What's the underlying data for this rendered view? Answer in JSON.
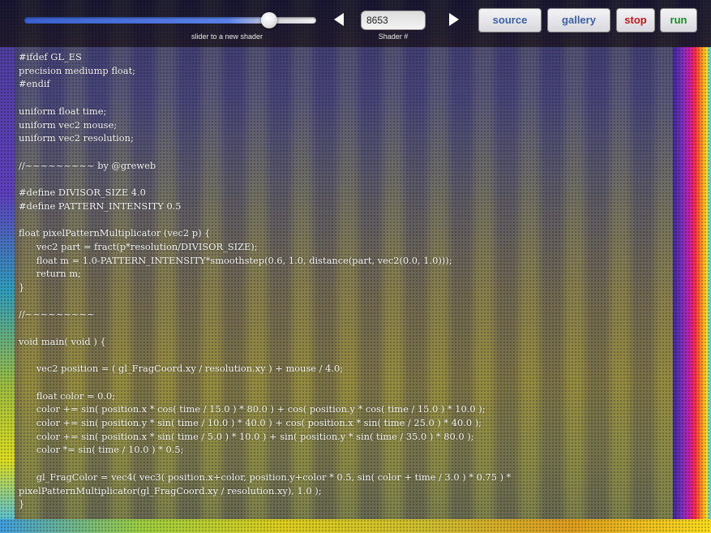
{
  "toolbar": {
    "slider_caption": "slider to a new shader",
    "slider_value": 0.84,
    "shader_number": "8653",
    "shader_caption": "Shader #",
    "source_label": "source",
    "gallery_label": "gallery",
    "stop_label": "stop",
    "run_label": "run",
    "prev_icon": "triangle-left",
    "next_icon": "triangle-right"
  },
  "colors": {
    "source_text": "#3a5fa8",
    "gallery_text": "#3a5fa8",
    "stop_text": "#c01818",
    "run_text": "#1a8a2a",
    "code_text": "#f2f2f2"
  },
  "code": "#ifdef GL_ES\nprecision mediump float;\n#endif\n\nuniform float time;\nuniform vec2 mouse;\nuniform vec2 resolution;\n\n//~~~~~~~~~ by @greweb\n\n#define DIVISOR_SIZE 4.0\n#define PATTERN_INTENSITY 0.5\n\nfloat pixelPatternMultiplicator (vec2 p) {\n      vec2 part = fract(p*resolution/DIVISOR_SIZE);\n      float m = 1.0-PATTERN_INTENSITY*smoothstep(0.6, 1.0, distance(part, vec2(0.0, 1.0)));\n      return m;\n}\n\n//~~~~~~~~~\n\nvoid main( void ) {\n\n      vec2 position = ( gl_FragCoord.xy / resolution.xy ) + mouse / 4.0;\n\n      float color = 0.0;\n      color += sin( position.x * cos( time / 15.0 ) * 80.0 ) + cos( position.y * cos( time / 15.0 ) * 10.0 );\n      color += sin( position.y * sin( time / 10.0 ) * 40.0 ) + cos( position.x * sin( time / 25.0 ) * 40.0 );\n      color += sin( position.x * sin( time / 5.0 ) * 10.0 ) + sin( position.y * sin( time / 35.0 ) * 80.0 );\n      color *= sin( time / 10.0 ) * 0.5;\n\n      gl_FragColor = vec4( vec3( position.x+color, position.y+color * 0.5, sin( color + time / 3.0 ) * 0.75 ) *\npixelPatternMultiplicator(gl_FragCoord.xy / resolution.xy), 1.0 );\n}"
}
